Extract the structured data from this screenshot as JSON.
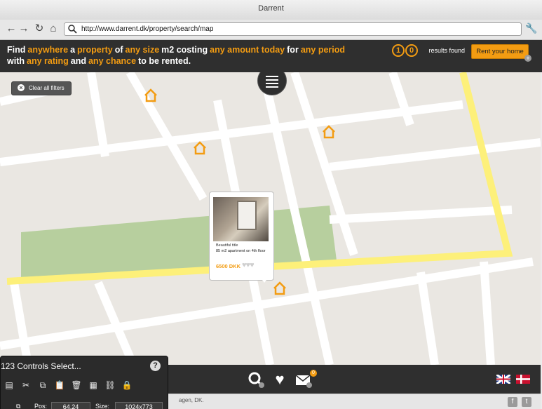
{
  "window": {
    "title": "Darrent"
  },
  "toolbar": {
    "url": "http://www.darrent.dk/property/search/map"
  },
  "header": {
    "line1": [
      {
        "text": "Find",
        "hl": false
      },
      {
        "text": "anywhere",
        "hl": true
      },
      {
        "text": "a",
        "hl": false
      },
      {
        "text": "property",
        "hl": true
      },
      {
        "text": "of",
        "hl": false
      },
      {
        "text": "any size",
        "hl": true
      },
      {
        "text": "m2 costing",
        "hl": false
      },
      {
        "text": "any amount today",
        "hl": true
      },
      {
        "text": "for",
        "hl": false
      },
      {
        "text": "any period",
        "hl": true
      }
    ],
    "line2": [
      {
        "text": "with",
        "hl": false
      },
      {
        "text": "any rating",
        "hl": true
      },
      {
        "text": "and",
        "hl": false
      },
      {
        "text": "any chance",
        "hl": true
      },
      {
        "text": "to be rented.",
        "hl": false
      }
    ],
    "results_digits": [
      "1",
      "0"
    ],
    "results_label": "results found",
    "rent_button": "Rent your home"
  },
  "map": {
    "clear_filters": "Clear all filters",
    "listing": {
      "title": "Beautiful title",
      "description": "85 m2 apartment on 4th floor",
      "price": "6500 DKK",
      "rating": 0
    }
  },
  "bottom": {
    "message_count": "0"
  },
  "footer": {
    "copyright": "agen, DK."
  },
  "palette": {
    "title": "123 Controls Select...",
    "help": "?",
    "pos_label": "Pos:",
    "pos_value": "64,24",
    "size_label": "Size:",
    "size_value": "1024x773"
  },
  "colors": {
    "accent": "#f39c12",
    "dark": "#2f2f2f",
    "map_bg": "#eae7e2",
    "road_major": "#fdf07a",
    "park": "#b7cf9e"
  }
}
